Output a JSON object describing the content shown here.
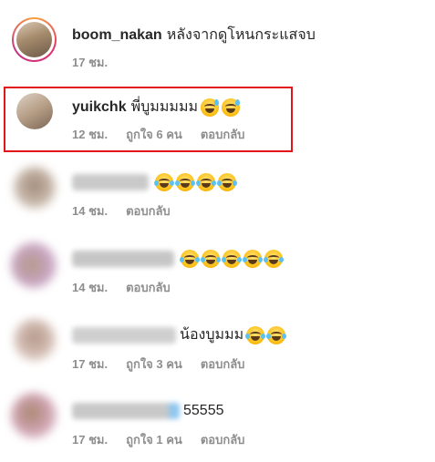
{
  "comments": [
    {
      "username": "boom_nakan",
      "text": "หลังจากดูโหนกระแสจบ",
      "time": "17 ชม."
    },
    {
      "username": "yuikchk",
      "text": "พี่บูมมมมม",
      "time": "12 ชม.",
      "likes": "ถูกใจ 6 คน",
      "reply": "ตอบกลับ"
    },
    {
      "username": "",
      "text": "",
      "time": "14 ชม.",
      "reply": "ตอบกลับ"
    },
    {
      "username": "",
      "text": "",
      "time": "14 ชม.",
      "reply": "ตอบกลับ"
    },
    {
      "username": "",
      "text": "น้องบูมมม",
      "time": "17 ชม.",
      "likes": "ถูกใจ 3 คน",
      "reply": "ตอบกลับ"
    },
    {
      "username": "",
      "text": "55555",
      "time": "17 ชม.",
      "likes": "ถูกใจ 1 คน",
      "reply": "ตอบกลับ"
    }
  ],
  "colors": {
    "highlight": "#e0161b",
    "meta": "#8e8e8e"
  },
  "icons": [
    "sweat-smile-emoji-icon",
    "tears-of-joy-emoji-icon"
  ]
}
